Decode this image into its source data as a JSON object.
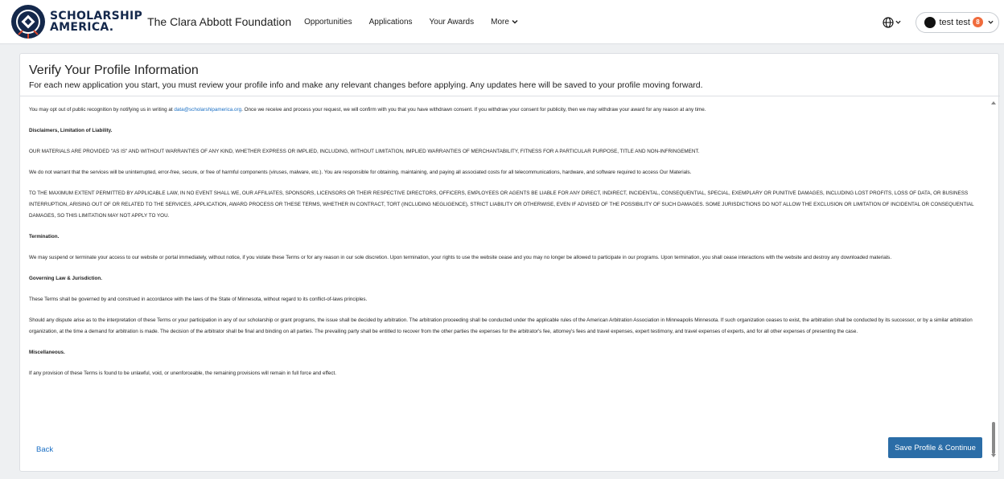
{
  "header": {
    "logo_line1": "SCHOLARSHIP",
    "logo_line2": "AMERICA.",
    "org_name": "The Clara Abbott Foundation",
    "nav": [
      {
        "label": "Opportunities"
      },
      {
        "label": "Applications"
      },
      {
        "label": "Your Awards"
      },
      {
        "label": "More"
      }
    ],
    "user_name": "test test",
    "notification_count": "8",
    "icons": {
      "language": "globe-icon",
      "dropdown": "chevron-down-icon"
    }
  },
  "page": {
    "title": "Verify Your Profile Information",
    "subtitle": "For each new application you start, you must review your profile info and make any relevant changes before applying. Any updates here will be saved to your profile moving forward."
  },
  "terms": {
    "p1_before": "You may opt out of public recognition by notifying us in writing at ",
    "p1_email": "data@scholarshipamerica.org",
    "p1_after": ". Once we receive and process your request, we will confirm with you that you have withdrawn consent. If you withdraw your consent for publicity, then we may withdraw your award for any reason at any time.",
    "h_disclaimers": "Disclaimers, Limitation of Liability.",
    "p_asis": "OUR MATERIALS ARE PROVIDED \"AS IS\" AND WITHOUT WARRANTIES OF ANY KIND, WHETHER EXPRESS OR IMPLIED, INCLUDING, WITHOUT LIMITATION, IMPLIED WARRANTIES OF MERCHANTABILITY, FITNESS FOR A PARTICULAR PURPOSE, TITLE AND NON-INFRINGEMENT.",
    "p_warrant": "We do not warrant that the services will be uninterrupted, error-free, secure, or free of harmful components (viruses, malware, etc.). You are responsible for obtaining, maintaining, and paying all associated costs for all telecommunications, hardware, and software required to access Our Materials.",
    "p_liability": "TO THE MAXIMUM EXTENT PERMITTED BY APPLICABLE LAW, IN NO EVENT SHALL WE, OUR AFFILIATES, SPONSORS, LICENSORS OR THEIR RESPECTIVE DIRECTORS, OFFICERS, EMPLOYEES OR AGENTS BE LIABLE FOR ANY DIRECT, INDIRECT, INCIDENTAL, CONSEQUENTIAL, SPECIAL, EXEMPLARY OR PUNITIVE DAMAGES, INCLUDING LOST PROFITS, LOSS OF DATA, OR BUSINESS INTERRUPTION, ARISING OUT OF OR RELATED TO THE SERVICES, APPLICATION, AWARD PROCESS OR THESE TERMS, WHETHER IN CONTRACT, TORT (INCLUDING NEGLIGENCE), STRICT LIABILITY OR OTHERWISE, EVEN IF ADVISED OF THE POSSIBILITY OF SUCH DAMAGES. SOME JURISDICTIONS DO NOT ALLOW THE EXCLUSION OR LIMITATION OF INCIDENTAL OR CONSEQUENTIAL DAMAGES, SO THIS LIMITATION MAY NOT APPLY TO YOU.",
    "h_termination": "Termination.",
    "p_termination": "We may suspend or terminate your access to our website or portal immediately, without notice, if you violate these Terms or for any reason in our sole discretion. Upon termination, your rights to use the website cease and you may no longer be allowed to participate in our programs. Upon termination, you shall cease interactions with the website and destroy any downloaded materials.",
    "h_governing": "Governing Law & Jurisdiction.",
    "p_governing": "These Terms shall be governed by and construed in accordance with the laws of the State of Minnesota, without regard to its conflict-of-laws principles.",
    "p_dispute": "Should any dispute arise as to the interpretation of these Terms or your participation in any of our scholarship or grant programs, the issue shall be decided by arbitration. The arbitration proceeding shall be conducted under the applicable rules of the American Arbitration Association in Minneapolis Minnesota. If such organization ceases to exist, the arbitration shall be conducted by its successor, or by a similar arbitration organization, at the time a demand for arbitration is made. The decision of the arbitrator shall be final and binding on all parties. The prevailing party shall be entitled to recover from the other parties the expenses for the arbitrator's fee, attorney's fees and travel expenses, expert testimony, and travel expenses of experts, and for all other expenses of presenting the case.",
    "h_misc": "Miscellaneous.",
    "p_misc": "If any provision of these Terms is found to be unlawful, void, or unenforceable, the remaining provisions will remain in full force and effect."
  },
  "actions": {
    "back_label": "Back",
    "save_label": "Save Profile & Continue"
  },
  "colors": {
    "brand_navy": "#14284b",
    "link": "#1a6fc4",
    "primary_button": "#2b6da7",
    "notification": "#f06b3c"
  }
}
